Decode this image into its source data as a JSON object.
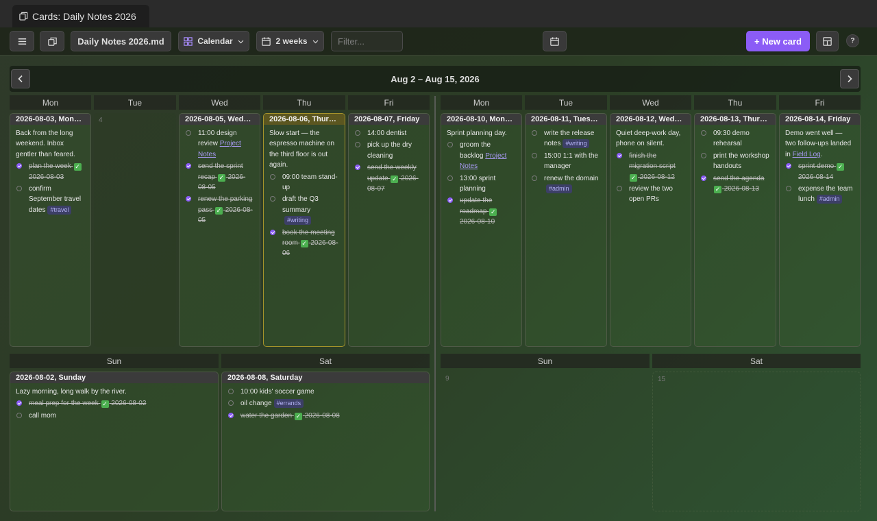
{
  "tab": {
    "title": "Cards: Daily Notes 2026"
  },
  "toolbar": {
    "file": "Daily Notes 2026.md",
    "view": "Calendar",
    "span": "2 weeks",
    "filter_placeholder": "Filter...",
    "new_card": "+ New card",
    "help": "?"
  },
  "nav": {
    "range": "Aug 2 – Aug 15, 2026"
  },
  "days": {
    "w1": [
      "Mon",
      "Tue",
      "Wed",
      "Thu",
      "Fri"
    ],
    "w2": [
      "Mon",
      "Tue",
      "Wed",
      "Thu",
      "Fri"
    ],
    "we1": [
      "Sun",
      "Sat"
    ],
    "we2": [
      "Sun",
      "Sat"
    ]
  },
  "empty": {
    "tue": "4",
    "sun2": "9",
    "sat2": "15"
  },
  "cards": {
    "mon3": {
      "title": "2026-08-03, Monday",
      "p": "Back from the long weekend. Inbox gentler than feared.",
      "t1": "plan the week",
      "d1": "2026-08-03",
      "t2": "confirm September travel dates",
      "tag2": "#travel"
    },
    "wed5": {
      "title": "2026-08-05, Wednesday",
      "t1": "11:00 design review",
      "l1": "Project Notes",
      "t2": "send the sprint recap",
      "d2": "2026-08-05",
      "t3": "renew the parking pass",
      "d3": "2026-08-05"
    },
    "thu6": {
      "title": "2026-08-06, Thursday",
      "p": "Slow start — the espresso machine on the third floor is out again.",
      "t1": "09:00 team stand-up",
      "t2": "draft the Q3 summary",
      "tag2": "#writing",
      "t3": "book the meeting room",
      "d3": "2026-08-06"
    },
    "fri7": {
      "title": "2026-08-07, Friday",
      "t1": "14:00 dentist",
      "t2": "pick up the dry cleaning",
      "t3": "send the weekly update",
      "d3": "2026-08-07"
    },
    "mon10": {
      "title": "2026-08-10, Monday",
      "p": "Sprint planning day.",
      "t1": "groom the backlog",
      "l1": "Project Notes",
      "t2": "13:00 sprint planning",
      "t3": "update the roadmap",
      "d3": "2026-08-10"
    },
    "tue11": {
      "title": "2026-08-11, Tuesday",
      "t1": "write the release notes",
      "tag1": "#writing",
      "t2": "15:00 1:1 with the manager",
      "t3": "renew the domain",
      "tag3": "#admin"
    },
    "wed12": {
      "title": "2026-08-12, Wednesday",
      "p": "Quiet deep-work day, phone on silent.",
      "t1": "finish the migration script",
      "d1": "2026-08-12",
      "t2": "review the two open PRs"
    },
    "thu13": {
      "title": "2026-08-13, Thursday",
      "t1": "09:30 demo rehearsal",
      "t2": "print the workshop handouts",
      "t3": "send the agenda",
      "d3": "2026-08-13"
    },
    "fri14": {
      "title": "2026-08-14, Friday",
      "p": "Demo went well — two follow-ups landed in",
      "plink": "Field Log",
      "t1": "sprint demo",
      "d1": "2026-08-14",
      "t2": "expense the team lunch",
      "tag2": "#admin"
    },
    "sun2": {
      "title": "2026-08-02, Sunday",
      "p": "Lazy morning, long walk by the river.",
      "t1": "meal prep for the week",
      "d1": "2026-08-02",
      "t2": "call mom"
    },
    "sat8": {
      "title": "2026-08-08, Saturday",
      "t1": "10:00 kids' soccer game",
      "t2": "oil change",
      "tag2": "#errands",
      "t3": "water the garden",
      "d3": "2026-08-08"
    }
  },
  "colors": {
    "accent": "#8b5cf6",
    "today_border": "#a5932a",
    "check": "#4caf50"
  }
}
